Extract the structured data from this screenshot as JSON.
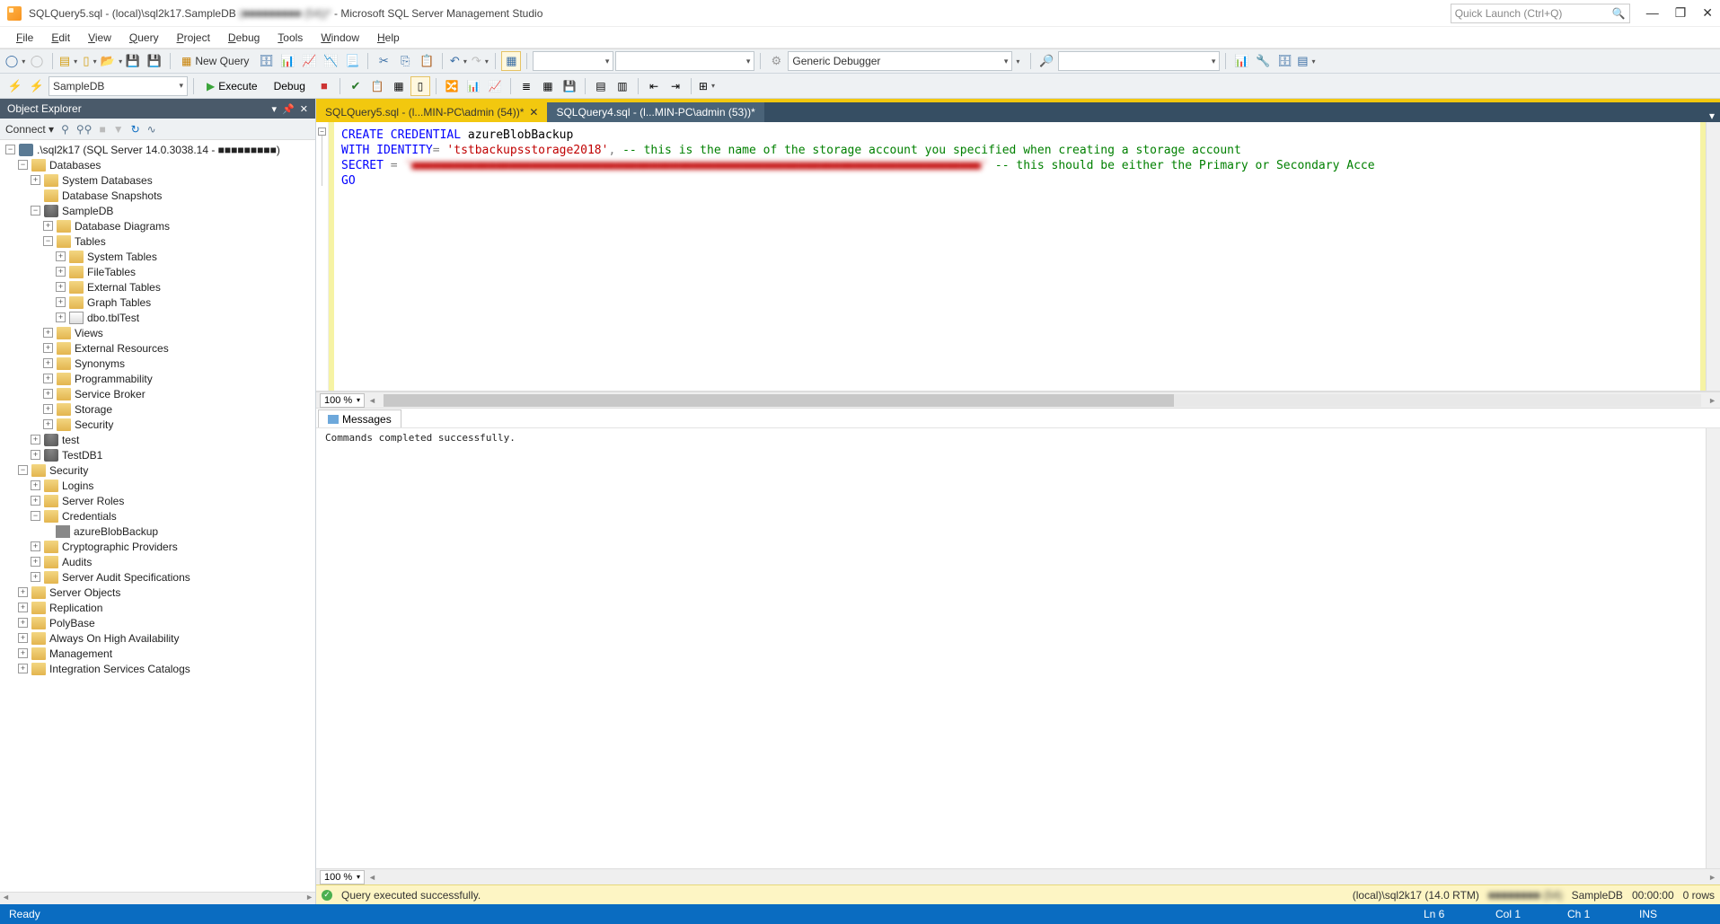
{
  "title": {
    "filename": "SQLQuery5.sql",
    "connection": "(local)\\sql2k17.SampleDB",
    "user_blur": "(■■■■■■■■■ (54))*",
    "app": "Microsoft SQL Server Management Studio"
  },
  "quick_launch_placeholder": "Quick Launch (Ctrl+Q)",
  "menu": [
    "File",
    "Edit",
    "View",
    "Query",
    "Project",
    "Debug",
    "Tools",
    "Window",
    "Help"
  ],
  "toolbar": {
    "new_query": "New Query",
    "debugger_label": "Generic Debugger"
  },
  "toolbar2": {
    "db_selector": "SampleDB",
    "execute": "Execute",
    "debug": "Debug"
  },
  "object_explorer": {
    "title": "Object Explorer",
    "connect": "Connect",
    "root": ".\\sql2k17 (SQL Server 14.0.3038.14 - ■■■■■■■■■)",
    "nodes": {
      "databases": "Databases",
      "system_databases": "System Databases",
      "database_snapshots": "Database Snapshots",
      "sampledb": "SampleDB",
      "database_diagrams": "Database Diagrams",
      "tables": "Tables",
      "system_tables": "System Tables",
      "filetables": "FileTables",
      "external_tables": "External Tables",
      "graph_tables": "Graph Tables",
      "dbo_tbltest": "dbo.tblTest",
      "views": "Views",
      "external_resources": "External Resources",
      "synonyms": "Synonyms",
      "programmability": "Programmability",
      "service_broker": "Service Broker",
      "storage": "Storage",
      "security_db": "Security",
      "test": "test",
      "testdb1": "TestDB1",
      "security": "Security",
      "logins": "Logins",
      "server_roles": "Server Roles",
      "credentials": "Credentials",
      "azure_blob_backup": "azureBlobBackup",
      "crypto_providers": "Cryptographic Providers",
      "audits": "Audits",
      "server_audit_specs": "Server Audit Specifications",
      "server_objects": "Server Objects",
      "replication": "Replication",
      "polybase": "PolyBase",
      "always_on": "Always On High Availability",
      "management": "Management",
      "integration_services": "Integration Services Catalogs"
    }
  },
  "tabs": [
    {
      "label": "SQLQuery5.sql - (l...MIN-PC\\admin (54))*",
      "active": true
    },
    {
      "label": "SQLQuery4.sql - (l...MIN-PC\\admin (53))*",
      "active": false
    }
  ],
  "code": {
    "l1_kw1": "CREATE",
    "l1_kw2": "CREDENTIAL",
    "l1_ident": " azureBlobBackup",
    "l2_kw1": "WITH",
    "l2_kw2": "IDENTITY",
    "l2_op": "=",
    "l2_str": "'tstbackupsstorage2018'",
    "l2_comma": ",",
    "l2_cmt": " -- this is the name of the storage account you specified when creating a storage account",
    "l3_kw": "SECRET",
    "l3_op": " = ",
    "l3_str_blur": "'■■■■■■■■■■■■■■■■■■■■■■■■■■■■■■■■■■■■■■■■■■■■■■■■■■■■■■■■■■■■■■■■■■■■■■■■■■■■■■■■■'",
    "l3_cmt": " -- this should be either the Primary or Secondary Acce",
    "l4": "GO"
  },
  "zoom": "100 %",
  "messages": {
    "tab": "Messages",
    "body": "Commands completed successfully."
  },
  "query_status": {
    "text": "Query executed successfully.",
    "server": "(local)\\sql2k17 (14.0 RTM)",
    "user_blur": "■■■■■■■■ (54)",
    "db": "SampleDB",
    "time": "00:00:00",
    "rows": "0 rows"
  },
  "status_bar": {
    "ready": "Ready",
    "ln": "Ln 6",
    "col": "Col 1",
    "ch": "Ch 1",
    "ins": "INS"
  }
}
